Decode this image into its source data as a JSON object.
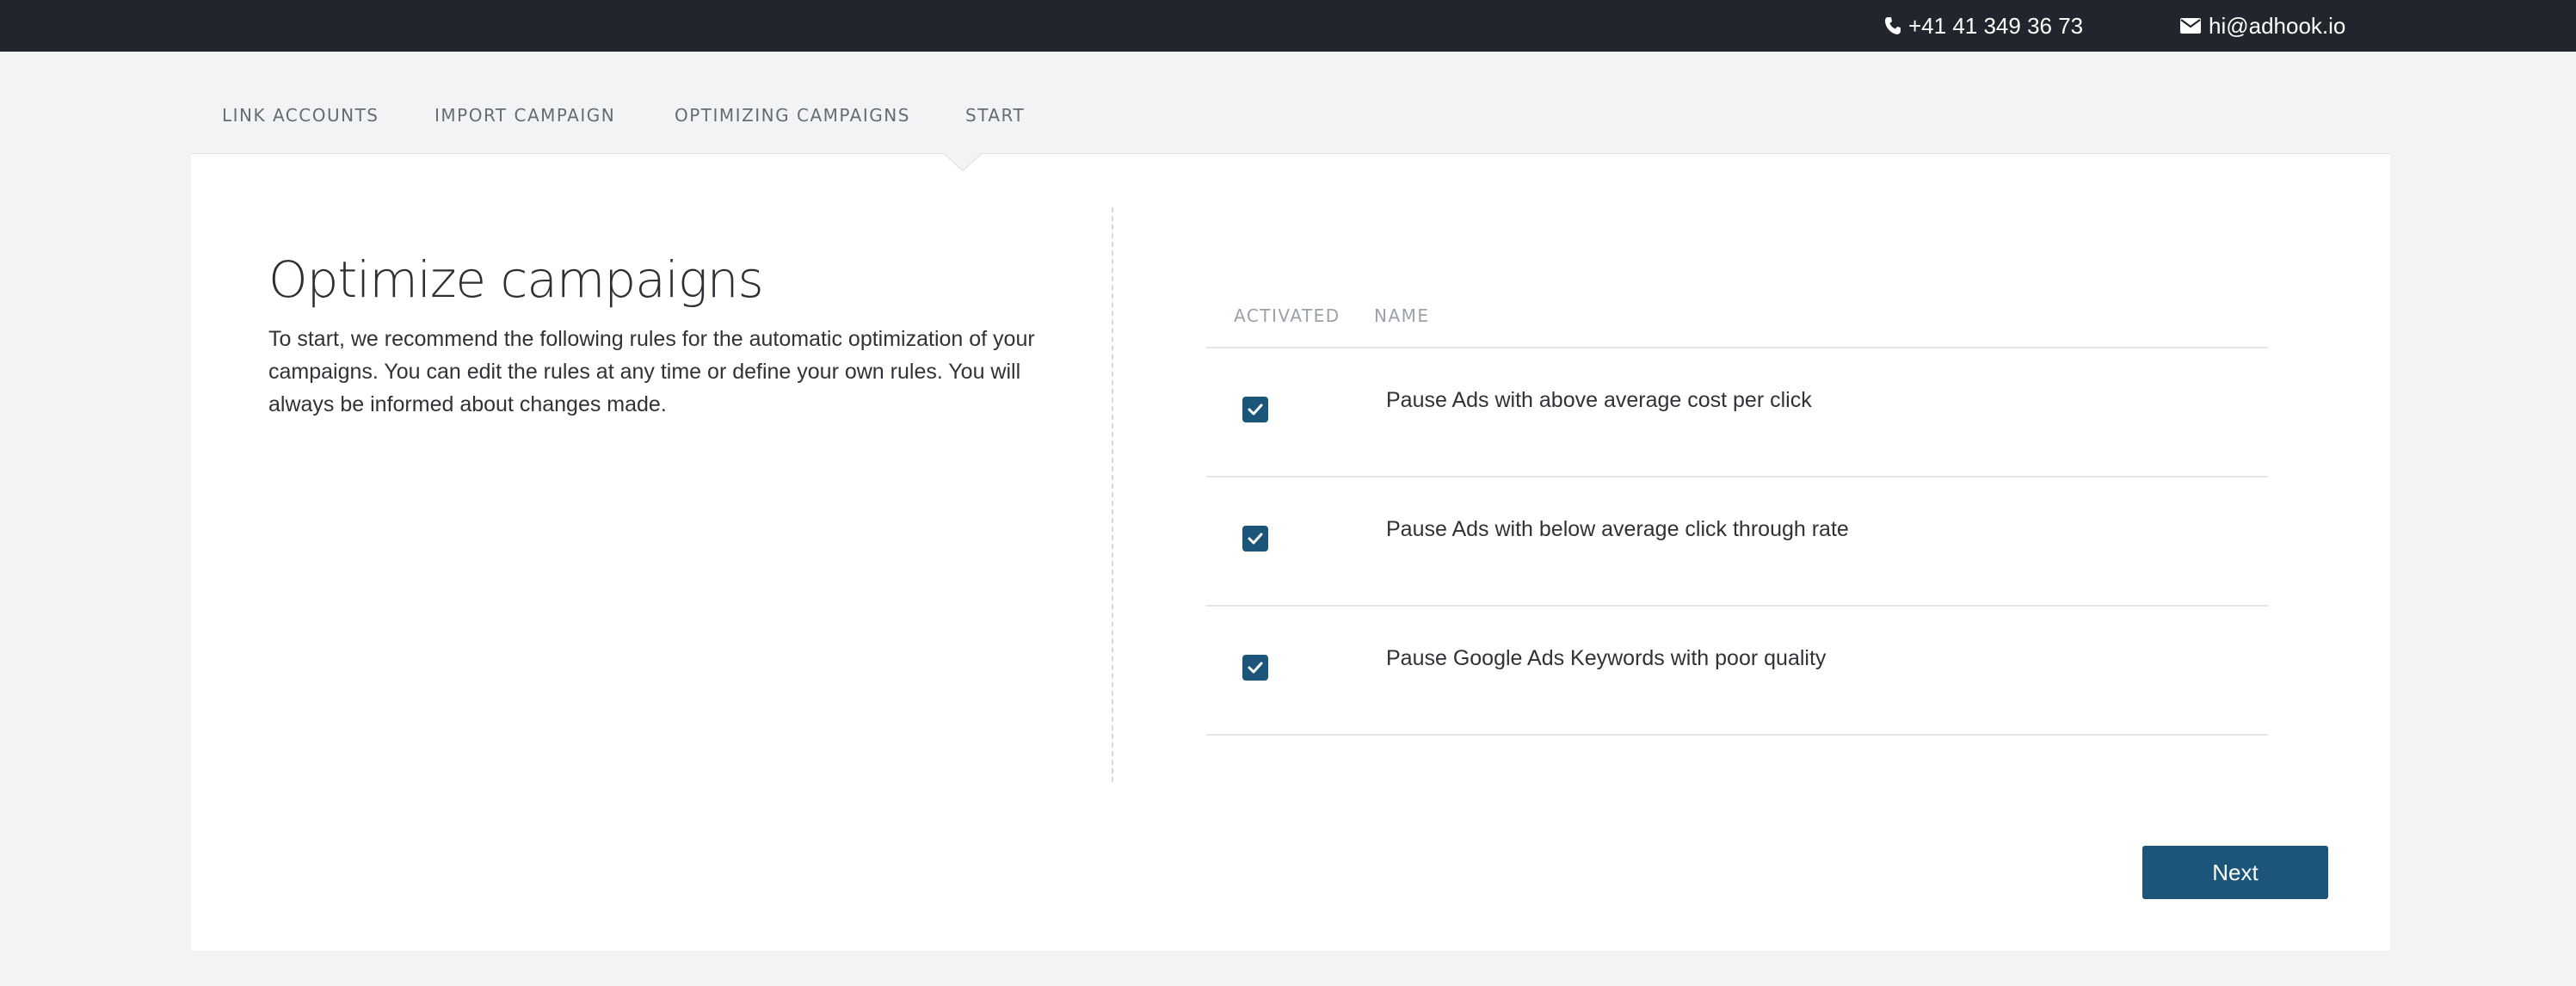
{
  "topbar": {
    "phone": "+41 41 349 36 73",
    "phone_icon": "phone-icon",
    "email": "hi@adhook.io",
    "email_icon": "envelope-icon"
  },
  "steps": [
    {
      "label": "LINK ACCOUNTS"
    },
    {
      "label": "IMPORT CAMPAIGN"
    },
    {
      "label": "OPTIMIZING CAMPAIGNS",
      "active": true
    },
    {
      "label": "START"
    }
  ],
  "main": {
    "title": "Optimize campaigns",
    "description": "To start, we recommend the following rules for the automatic optimization of your campaigns. You can edit the rules at any time or define your own rules. You will always be informed about changes made."
  },
  "rules_table": {
    "headers": {
      "activated": "ACTIVATED",
      "name": "NAME"
    },
    "rows": [
      {
        "activated": true,
        "name": "Pause Ads with above average cost per click"
      },
      {
        "activated": true,
        "name": "Pause Ads with below average click through rate"
      },
      {
        "activated": true,
        "name": "Pause Google Ads Keywords with poor quality"
      }
    ]
  },
  "actions": {
    "next_label": "Next"
  },
  "colors": {
    "topbar": "#21252c",
    "background": "#f2f3f5",
    "accent": "#1b5579"
  }
}
